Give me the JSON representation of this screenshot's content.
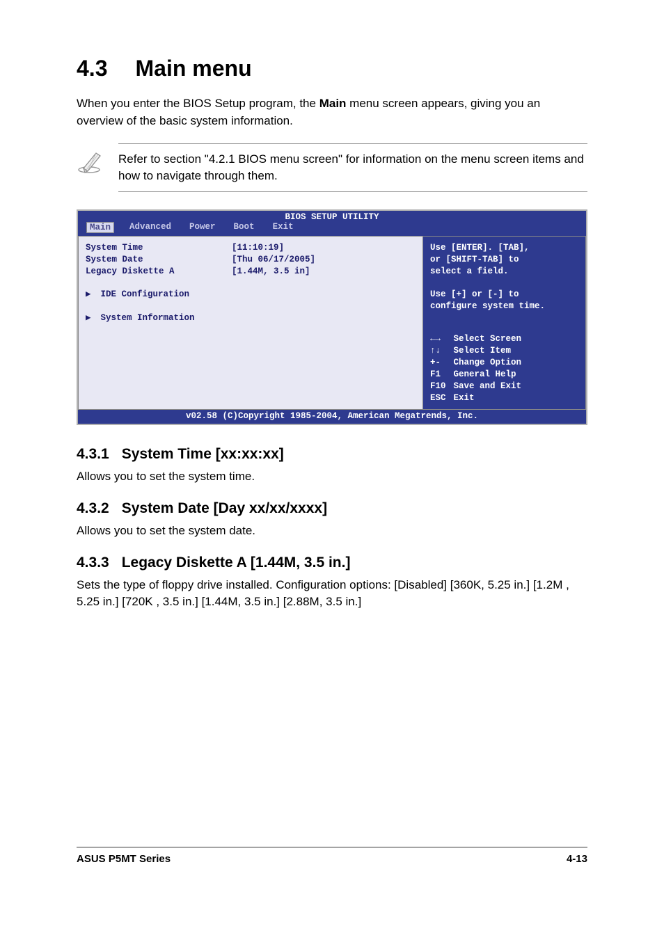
{
  "page": {
    "h1_num": "4.3",
    "h1_text": "Main menu",
    "intro_before": "When you enter the BIOS Setup program, the ",
    "intro_main": "Main",
    "intro_after": " menu screen appears, giving you an overview of the basic system information.",
    "note": "Refer to section \"4.2.1  BIOS menu screen\" for information on the menu screen items and how to navigate through them."
  },
  "bios": {
    "title": "BIOS SETUP UTILITY",
    "tabs": [
      "Main",
      "Advanced",
      "Power",
      "Boot",
      "Exit"
    ],
    "active_tab": "Main",
    "labels": {
      "system_time": "System Time",
      "system_date": "System Date",
      "legacy_diskette": "Legacy Diskette A",
      "ide_config": "IDE Configuration",
      "sys_info": "System Information"
    },
    "values": {
      "system_time": "[11:10:19]",
      "system_date": "[Thu 06/17/2005]",
      "legacy_diskette": "[1.44M, 3.5 in]"
    },
    "help_top1": "Use [ENTER]. [TAB],",
    "help_top2": "or [SHIFT-TAB] to",
    "help_top3": "select a field.",
    "help_top4": "Use [+] or [-] to",
    "help_top5": "configure system time.",
    "nav": {
      "select_screen": "Select Screen",
      "select_item": "Select Item",
      "change_option": "Change Option",
      "general_help": "General Help",
      "save_exit": "Save and Exit",
      "exit": "Exit",
      "k_arrows_lr": "←→",
      "k_arrows_ud": "↑↓",
      "k_pm": "+-",
      "k_f1": "F1",
      "k_f10": "F10",
      "k_esc": "ESC"
    },
    "footer": "v02.58 (C)Copyright 1985-2004, American Megatrends, Inc."
  },
  "sections": {
    "s1_num": "4.3.1",
    "s1_title": "System Time [xx:xx:xx]",
    "s1_body": "Allows you to set the system time.",
    "s2_num": "4.3.2",
    "s2_title": "System Date [Day xx/xx/xxxx]",
    "s2_body": "Allows you to set the system date.",
    "s3_num": "4.3.3",
    "s3_title": "Legacy Diskette A [1.44M, 3.5 in.]",
    "s3_body": "Sets the type of floppy drive installed. Configuration options: [Disabled] [360K, 5.25 in.] [1.2M , 5.25 in.] [720K , 3.5 in.] [1.44M, 3.5 in.] [2.88M, 3.5 in.]"
  },
  "footer": {
    "left": "ASUS P5MT Series",
    "right": "4-13"
  }
}
